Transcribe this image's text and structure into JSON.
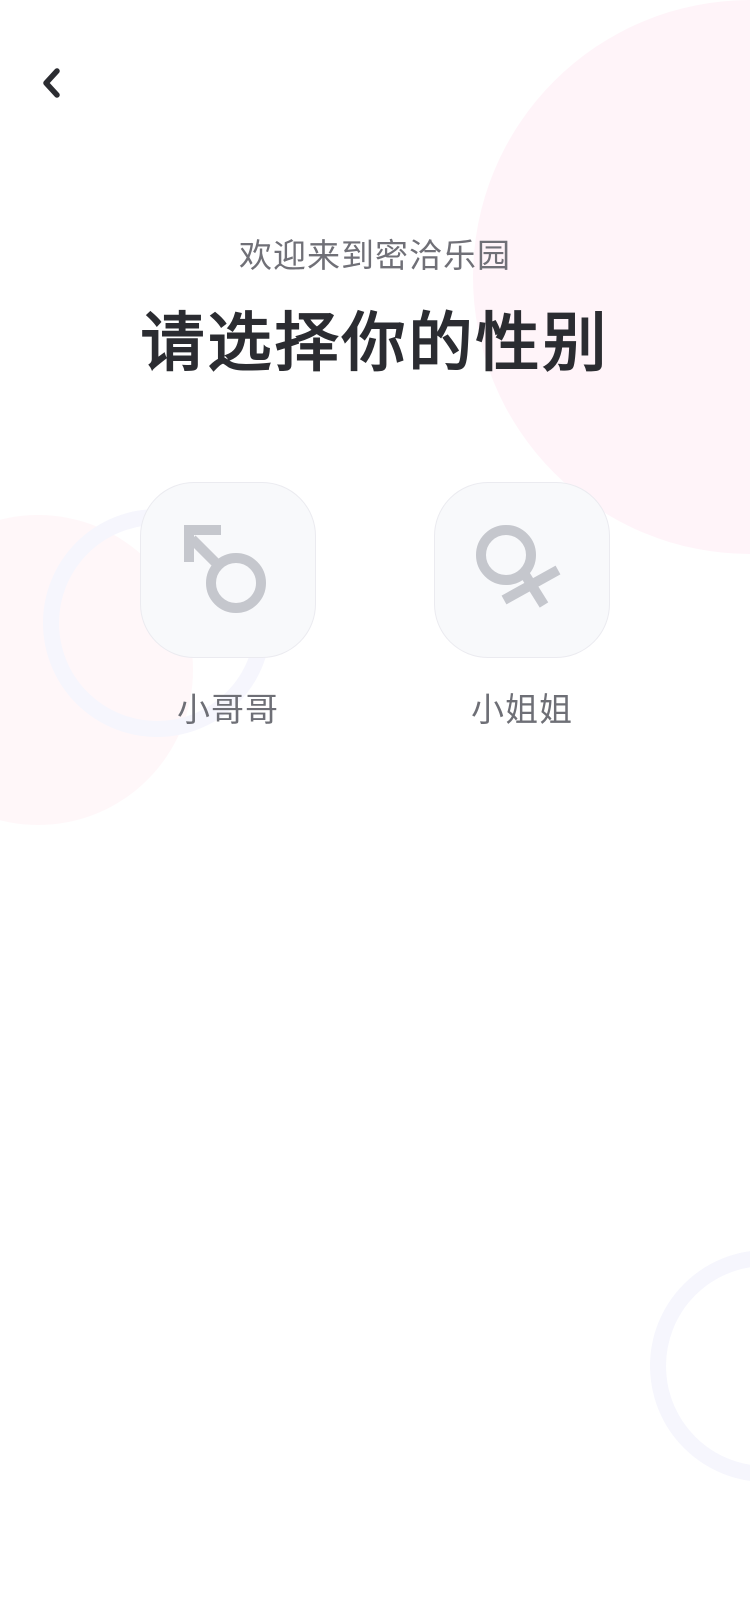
{
  "header": {
    "back_icon": "chevron-left-icon"
  },
  "welcome": {
    "subtitle": "欢迎来到密洽乐园",
    "title": "请选择你的性别"
  },
  "gender_options": [
    {
      "label": "小哥哥",
      "icon": "male-symbol-icon"
    },
    {
      "label": "小姐姐",
      "icon": "female-symbol-icon"
    }
  ],
  "colors": {
    "title_text": "#2b2c31",
    "subtitle_text": "#707077",
    "icon_gray": "#c5c7cd",
    "option_bg": "#f8f9fb",
    "decoration_pink": "#fff3f8",
    "decoration_lavender": "#f5f5fd"
  }
}
